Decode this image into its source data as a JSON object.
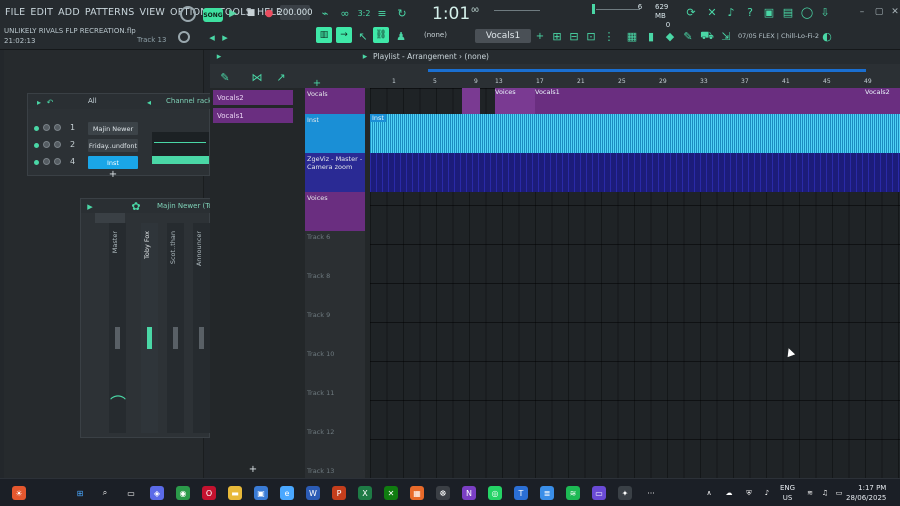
{
  "menu": {
    "items": [
      "FILE",
      "EDIT",
      "ADD",
      "PATTERNS",
      "VIEW",
      "OPTIONS",
      "TOOLS",
      "HELP"
    ]
  },
  "project": {
    "title": "UNLIKELY RIVALS FLP RECREATION.flp",
    "timecode": "21:02:13",
    "hint": "Track 13"
  },
  "transport": {
    "song": "SONG",
    "bpm": "200.000",
    "time": "1:01",
    "time_sub": "00",
    "pattern": "Vocals1",
    "pattern_none": "(none)",
    "cpu_num": "6",
    "mem": "629 MB",
    "mem2": "0"
  },
  "preset": {
    "label": "07/05 FLEX | Chill-Lo-Fi-2"
  },
  "channel_rack": {
    "filter": "All",
    "title": "Channel rack",
    "channels": [
      {
        "num": "1",
        "name": "Majin Newer"
      },
      {
        "num": "2",
        "name": "Friday..undfont"
      },
      {
        "num": "4",
        "name": "Inst"
      }
    ]
  },
  "mixer": {
    "title": "Majin Newer (To",
    "strips": [
      "Master",
      "Toby Fox",
      "Scot..than",
      "Announcer"
    ]
  },
  "playlist": {
    "title": "Playlist - Arrangement",
    "pattern": "(none)",
    "ruler": [
      "1",
      "5",
      "9",
      "13",
      "17",
      "21",
      "25",
      "29",
      "33",
      "37",
      "41",
      "45",
      "49"
    ],
    "picker": [
      "Vocals2",
      "Vocals1"
    ],
    "tracks": [
      {
        "name": "Vocals"
      },
      {
        "name": "Inst"
      },
      {
        "name": "ZgeViz - Master - Camera zoom"
      },
      {
        "name": "Voices"
      },
      {
        "name": "Track 6"
      },
      {
        "name": "Track 8"
      },
      {
        "name": "Track 9"
      },
      {
        "name": "Track 10"
      },
      {
        "name": "Track 11"
      },
      {
        "name": "Track 12"
      },
      {
        "name": "Track 13"
      }
    ],
    "clips": {
      "voices_label": "Voices",
      "vocals1": "Vocals1",
      "vocals2": "Vocals2",
      "inst": "Inst"
    }
  },
  "taskbar": {
    "lang": "ENG",
    "region": "US",
    "time": "1:17 PM",
    "date": "28/06/2025"
  }
}
